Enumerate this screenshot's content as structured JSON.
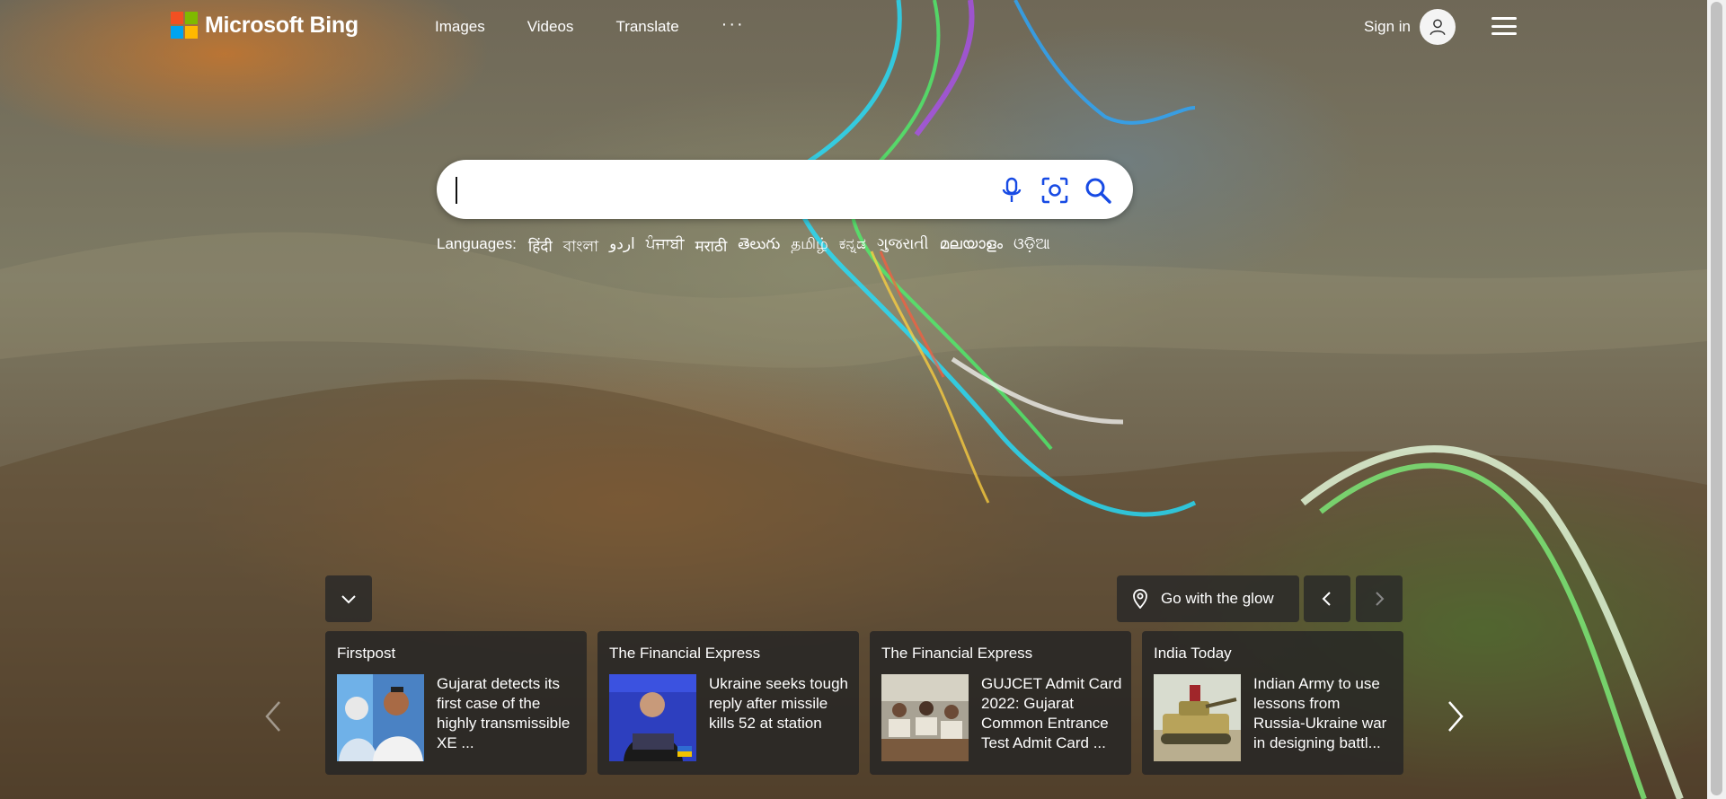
{
  "brand": {
    "name": "Microsoft Bing",
    "logo_colors": [
      "#f25022",
      "#7fba00",
      "#00a4ef",
      "#ffb900"
    ]
  },
  "nav": {
    "items": [
      {
        "label": "Images"
      },
      {
        "label": "Videos"
      },
      {
        "label": "Translate"
      }
    ],
    "more_label": "···"
  },
  "account": {
    "signin_label": "Sign in",
    "avatar_icon": "person-icon",
    "menu_icon": "hamburger-menu-icon"
  },
  "search": {
    "value": "",
    "placeholder": "",
    "icons": [
      "microphone-icon",
      "visual-search-icon",
      "search-icon"
    ],
    "accent": "#174ae4"
  },
  "languages": {
    "label": "Languages:",
    "items": [
      "हिंदी",
      "বাংলা",
      "اردو",
      "ਪੰਜਾਬੀ",
      "मराठी",
      "తెలుగు",
      "தமிழ்",
      "ಕನ್ನಡ",
      "ગુજરાતી",
      "മലയാളം",
      "ଓଡ଼ିଆ"
    ]
  },
  "image_bar": {
    "collapse_icon": "chevron-down-icon",
    "location_icon": "location-pin-icon",
    "caption": "Go with the glow",
    "prev_icon": "chevron-left-icon",
    "next_icon": "chevron-right-icon"
  },
  "news": {
    "prev_icon": "chevron-left-icon",
    "next_icon": "chevron-right-icon",
    "cards": [
      {
        "source": "Firstpost",
        "headline": "Gujarat detects its first case of the highly transmissible XE ..."
      },
      {
        "source": "The Financial Express",
        "headline": "Ukraine seeks tough reply after missile kills 52 at station"
      },
      {
        "source": "The Financial Express",
        "headline": "GUJCET Admit Card 2022: Gujarat Common Entrance Test Admit Card ..."
      },
      {
        "source": "India Today",
        "headline": "Indian Army to use lessons from Russia-Ukraine war in designing battl..."
      }
    ]
  }
}
